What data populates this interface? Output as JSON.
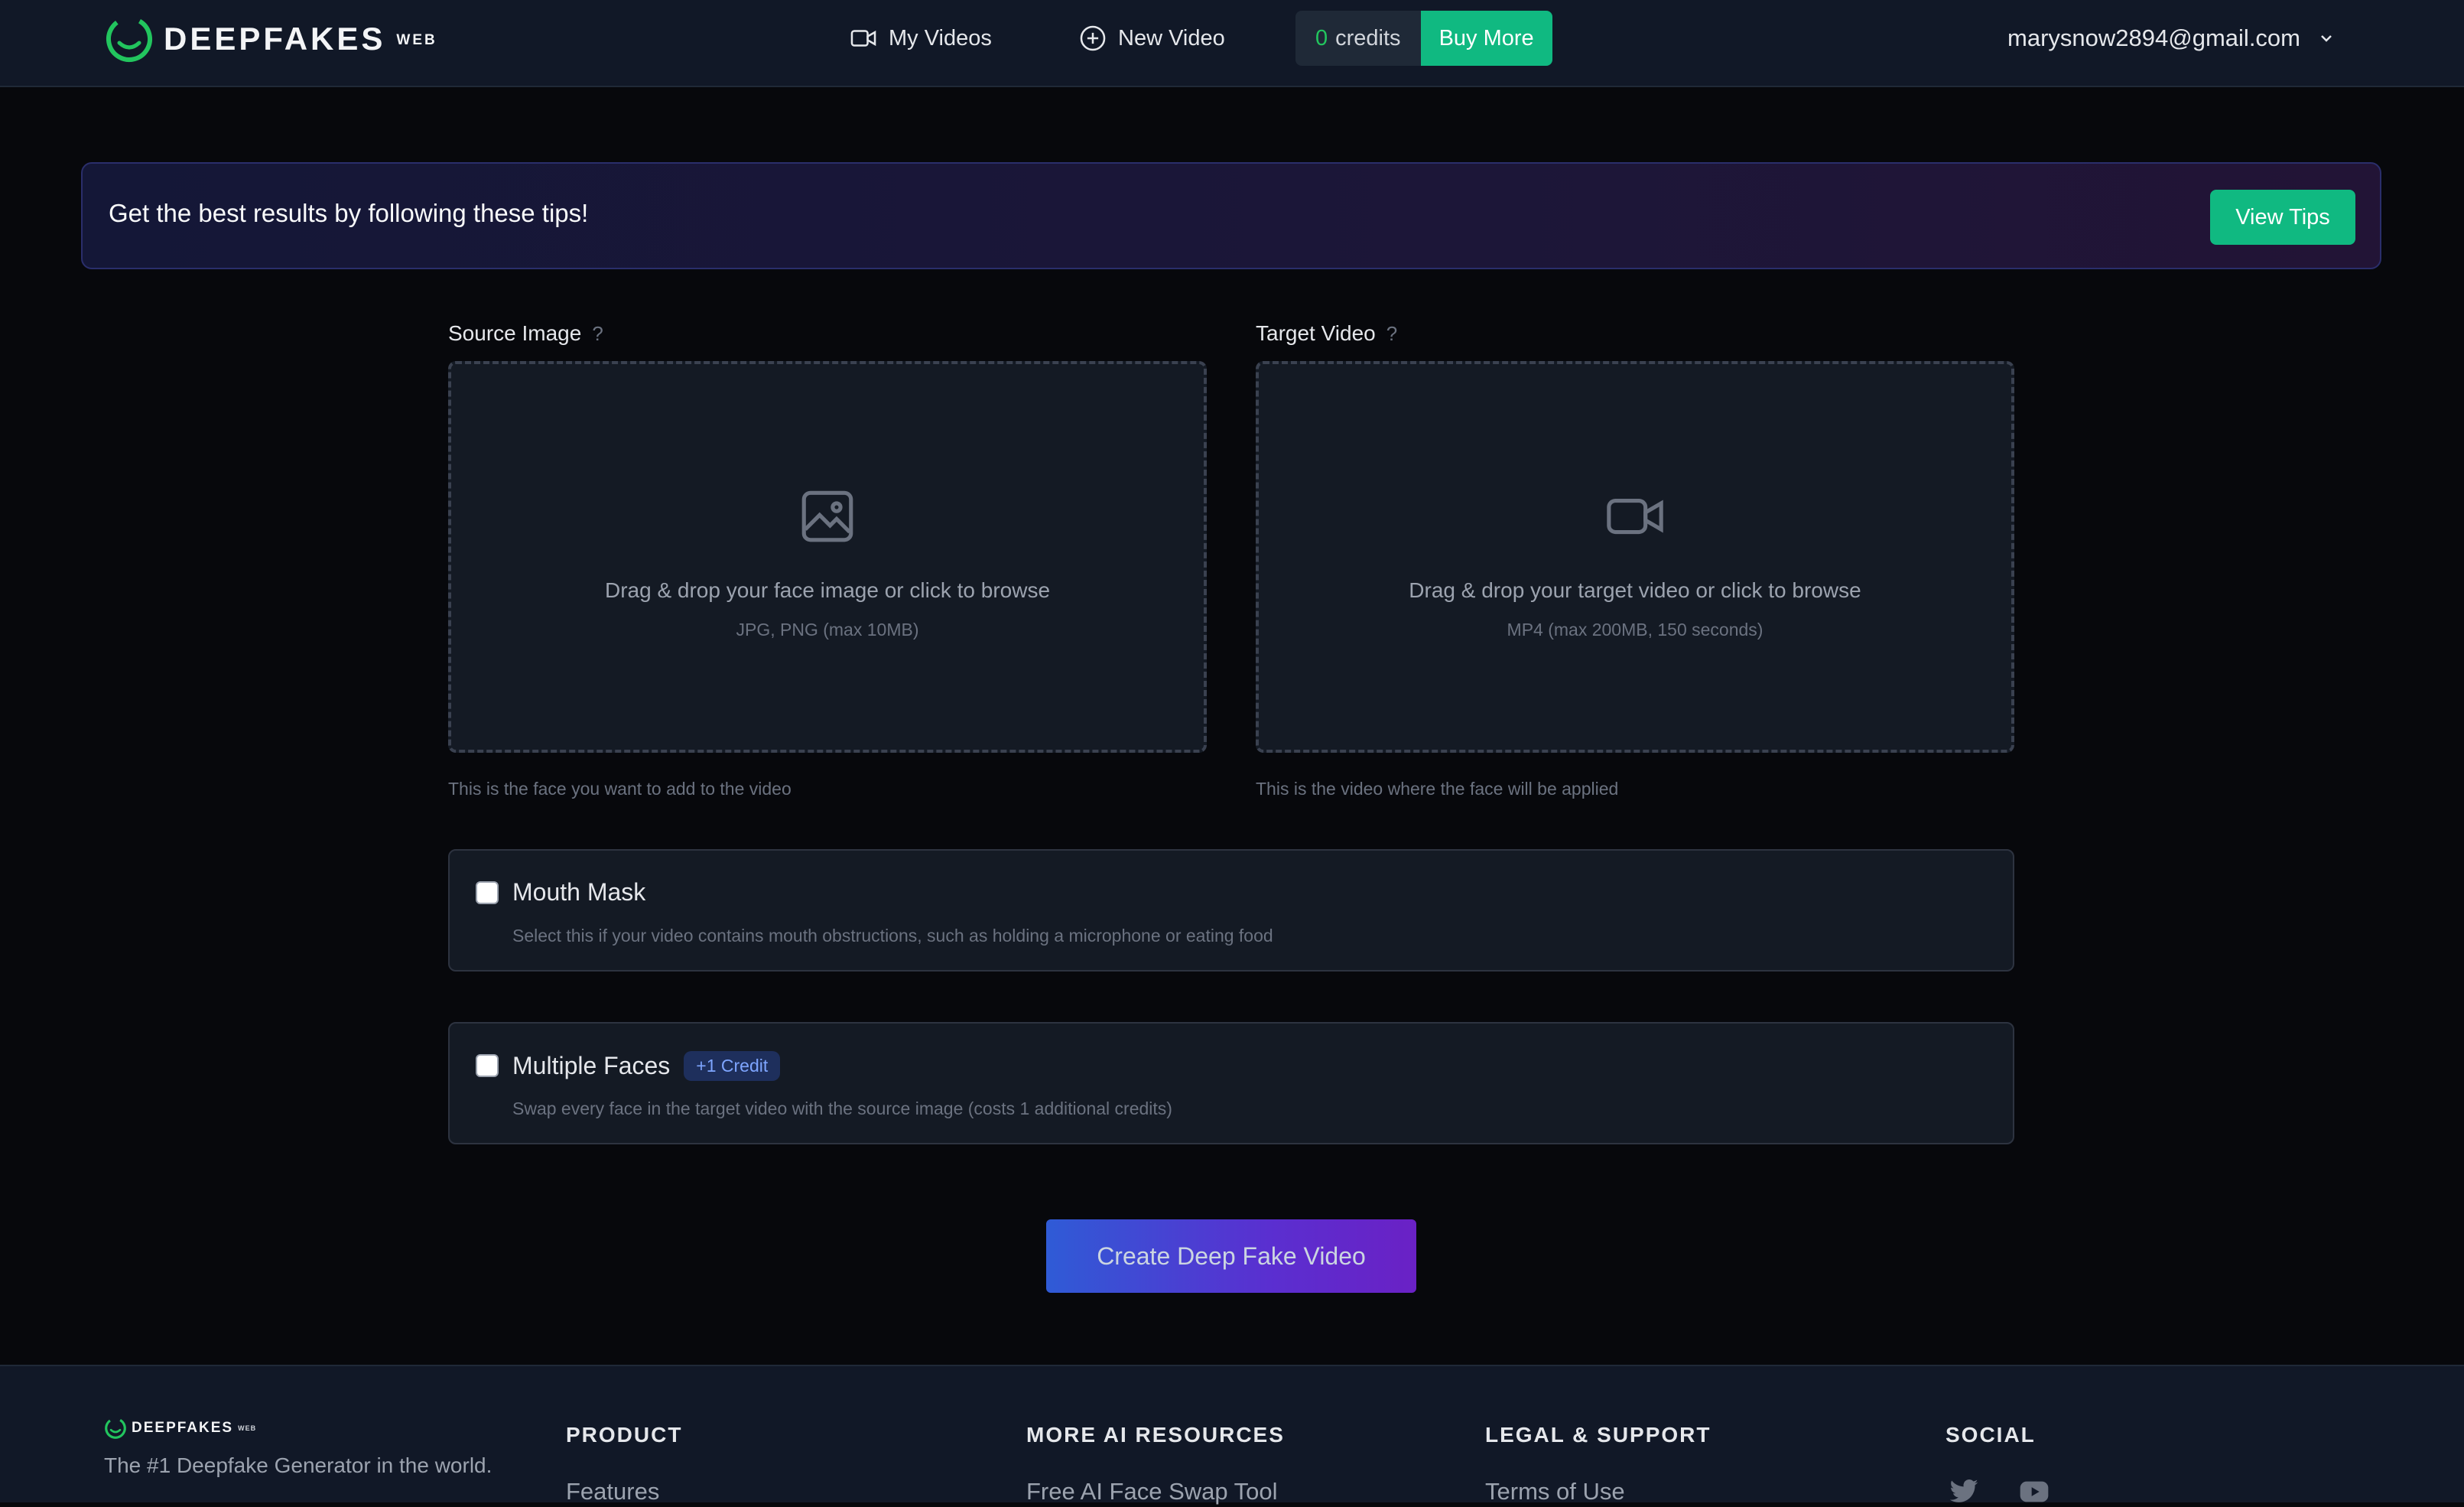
{
  "header": {
    "brand": "DEEPFAKES",
    "brand_sub": "WEB",
    "nav": {
      "my_videos": "My Videos",
      "new_video": "New Video"
    },
    "credits": {
      "count": "0",
      "label": "credits",
      "buy_more": "Buy More"
    },
    "user_email": "marysnow2894@gmail.com"
  },
  "tips": {
    "text": "Get the best results by following these tips!",
    "button": "View Tips"
  },
  "source": {
    "label": "Source Image",
    "help_mark": "?",
    "drop_text": "Drag & drop your face image or click to browse",
    "drop_sub": "JPG, PNG (max 10MB)",
    "help": "This is the face you want to add to the video"
  },
  "target": {
    "label": "Target Video",
    "help_mark": "?",
    "drop_text": "Drag & drop your target video or click to browse",
    "drop_sub": "MP4 (max 200MB, 150 seconds)",
    "help": "This is the video where the face will be applied"
  },
  "options": {
    "mouth_mask": {
      "title": "Mouth Mask",
      "desc": "Select this if your video contains mouth obstructions, such as holding a microphone or eating food",
      "checked": false
    },
    "multiple_faces": {
      "title": "Multiple Faces",
      "badge": "+1 Credit",
      "desc": "Swap every face in the target video with the source image (costs 1 additional credits)",
      "checked": false
    }
  },
  "create_button": "Create Deep Fake Video",
  "footer": {
    "brand": "DEEPFAKES",
    "brand_sub": "WEB",
    "tagline": "The #1 Deepfake Generator in the world.",
    "columns": [
      {
        "title": "PRODUCT",
        "first_link": "Features"
      },
      {
        "title": "MORE AI RESOURCES",
        "first_link": "Free AI Face Swap Tool"
      },
      {
        "title": "LEGAL & SUPPORT",
        "first_link": "Terms of Use"
      },
      {
        "title": "SOCIAL"
      }
    ],
    "social_icons": [
      "twitter-icon",
      "youtube-icon"
    ]
  },
  "colors": {
    "accent_green": "#10b981",
    "background": "#07080c",
    "panel": "#141a24",
    "header": "#111827"
  }
}
